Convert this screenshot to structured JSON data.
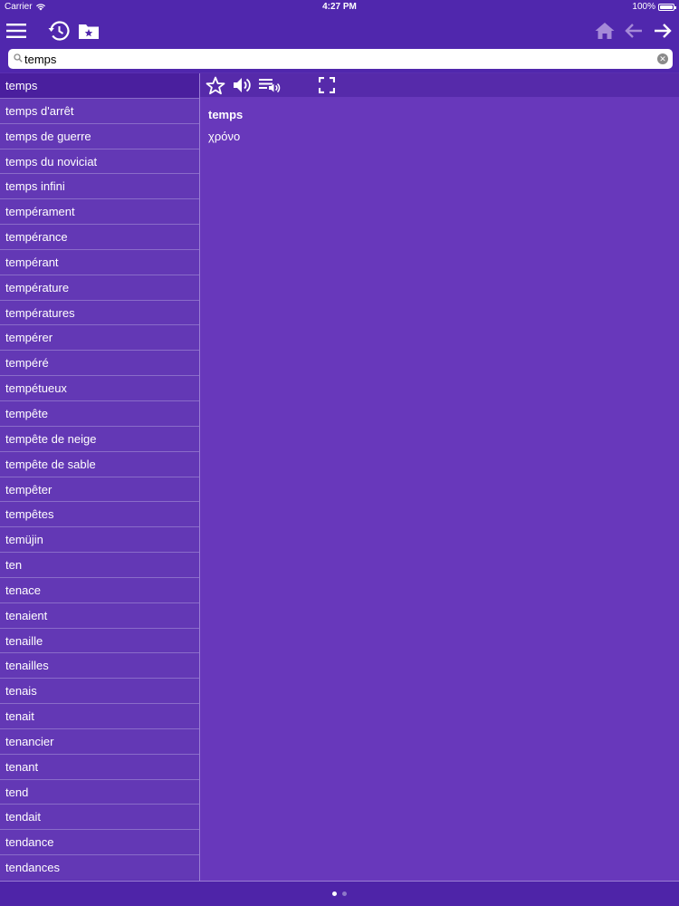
{
  "status_bar": {
    "carrier": "Carrier",
    "time": "4:27 PM",
    "battery": "100%"
  },
  "toolbar": {
    "left_icons": [
      "menu-icon",
      "history-icon",
      "favorites-folder-icon"
    ],
    "right_icons": [
      "home-icon",
      "back-arrow-icon",
      "forward-arrow-icon"
    ]
  },
  "search": {
    "value": "temps",
    "placeholder": ""
  },
  "word_list": {
    "selected_index": 0,
    "items": [
      "temps",
      "temps d'arrêt",
      "temps de guerre",
      "temps du noviciat",
      "temps infini",
      "tempérament",
      "tempérance",
      "tempérant",
      "température",
      "températures",
      "tempérer",
      "tempéré",
      "tempétueux",
      "tempête",
      "tempête de neige",
      "tempête de sable",
      "tempêter",
      "tempêtes",
      "temüjin",
      "ten",
      "tenace",
      "tenaient",
      "tenaille",
      "tenailles",
      "tenais",
      "tenait",
      "tenancier",
      "tenant",
      "tend",
      "tendait",
      "tendance",
      "tendances"
    ]
  },
  "detail": {
    "toolbar_icons": [
      "star-icon",
      "speaker-icon",
      "playlist-audio-icon",
      "fullscreen-icon"
    ],
    "word": "temps",
    "translation": "χρόνο"
  },
  "page_indicator": {
    "count": 2,
    "active": 0
  },
  "colors": {
    "background": "#5a2fb0",
    "list": "#6338b5",
    "selected": "#4a1f9e",
    "detail": "#6838bb"
  }
}
